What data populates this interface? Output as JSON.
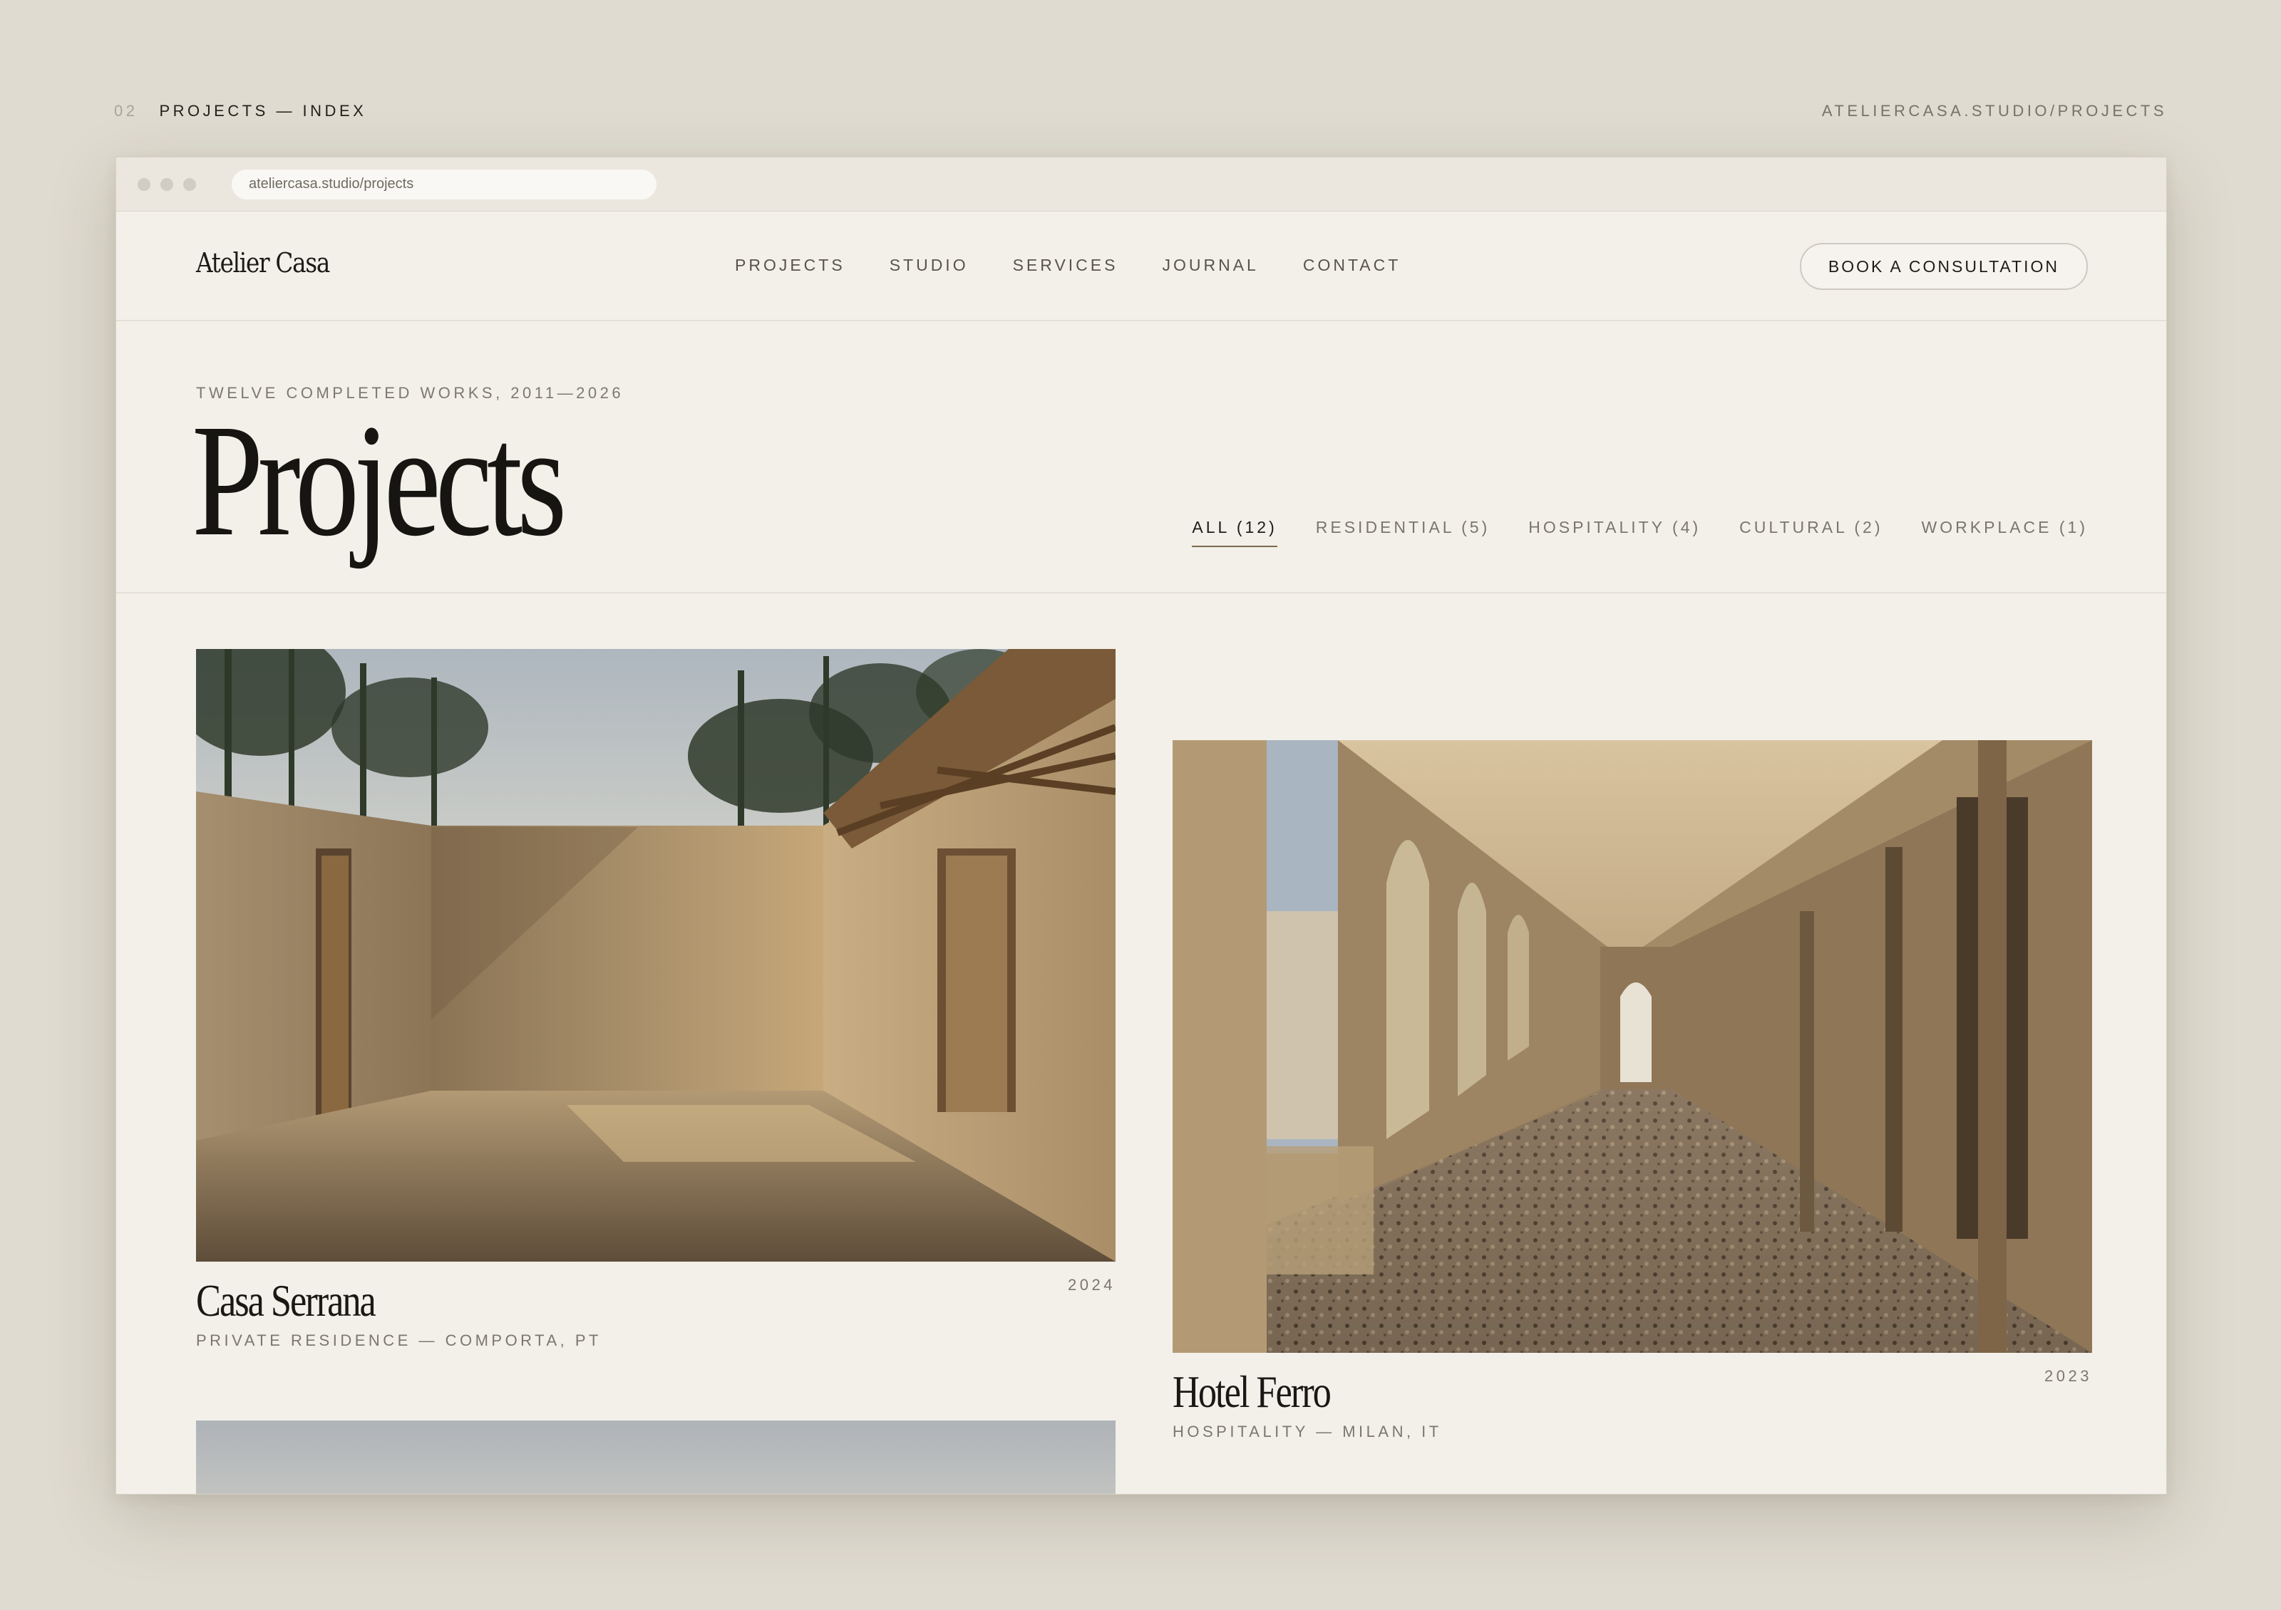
{
  "frame": {
    "index_number": "02",
    "index_title": "PROJECTS — INDEX",
    "url_label": "ATELIERCASA.STUDIO/PROJECTS"
  },
  "browser": {
    "address": "ateliercasa.studio/projects"
  },
  "site": {
    "logo": "Atelier Casa",
    "nav": [
      "PROJECTS",
      "STUDIO",
      "SERVICES",
      "JOURNAL",
      "CONTACT"
    ],
    "cta": "BOOK A CONSULTATION"
  },
  "hero": {
    "eyebrow": "TWELVE COMPLETED WORKS, 2011—2026",
    "title": "Projects",
    "filters": [
      {
        "label": "ALL (12)",
        "active": true
      },
      {
        "label": "RESIDENTIAL (5)",
        "active": false
      },
      {
        "label": "HOSPITALITY (4)",
        "active": false
      },
      {
        "label": "CULTURAL (2)",
        "active": false
      },
      {
        "label": "WORKPLACE (1)",
        "active": false
      }
    ]
  },
  "projects": [
    {
      "name": "Casa Serrana",
      "meta": "PRIVATE RESIDENCE — COMPORTA, PT",
      "year": "2024"
    },
    {
      "name": "Hotel Ferro",
      "meta": "HOSPITALITY — MILAN, IT",
      "year": "2023"
    }
  ],
  "colors": {
    "background": "#dfdbd0",
    "page": "#f3f0ea",
    "accent": "#7c6a4c"
  }
}
